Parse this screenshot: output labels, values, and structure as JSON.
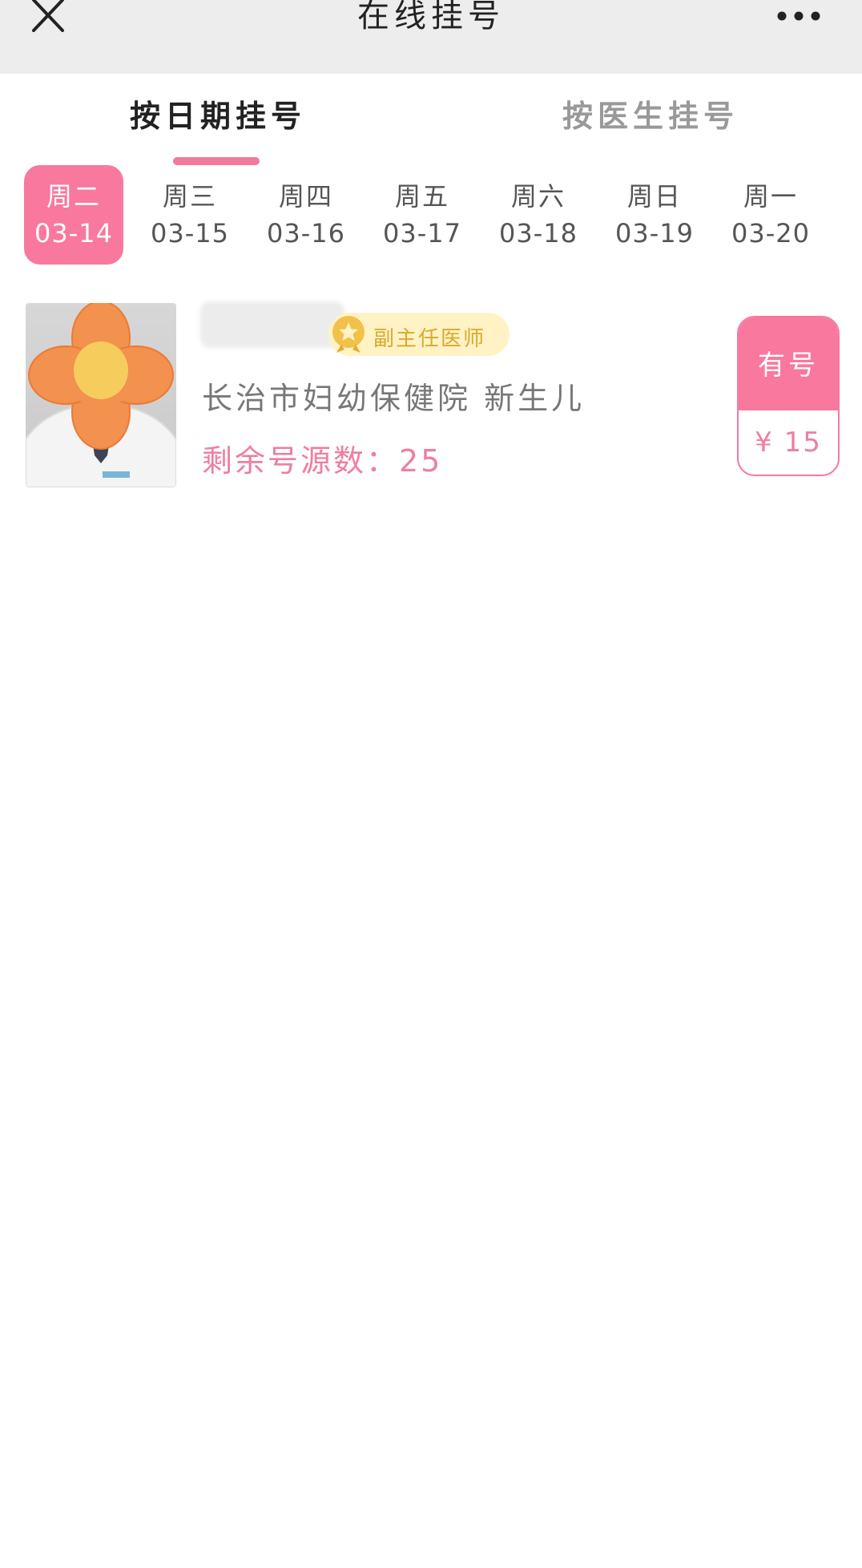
{
  "header": {
    "title": "在线挂号"
  },
  "tabs": [
    {
      "label": "按日期挂号"
    },
    {
      "label": "按医生挂号"
    }
  ],
  "days": [
    {
      "weekday": "周二",
      "date": "03-14"
    },
    {
      "weekday": "周三",
      "date": "03-15"
    },
    {
      "weekday": "周四",
      "date": "03-16"
    },
    {
      "weekday": "周五",
      "date": "03-17"
    },
    {
      "weekday": "周六",
      "date": "03-18"
    },
    {
      "weekday": "周日",
      "date": "03-19"
    },
    {
      "weekday": "周一",
      "date": "03-20"
    }
  ],
  "doctor": {
    "title": "副主任医师",
    "department": "长治市妇幼保健院 新生儿",
    "remaining": "剩余号源数：25",
    "status": "有号",
    "price": "¥ 15"
  },
  "colors": {
    "accent": "#f8789e",
    "header_bg": "#ededed",
    "badge_bg": "#fff2c4",
    "badge_text": "#d8aa2c"
  },
  "icons": {
    "close": "close-icon",
    "more": "more-icon",
    "badge": "medal-icon"
  }
}
